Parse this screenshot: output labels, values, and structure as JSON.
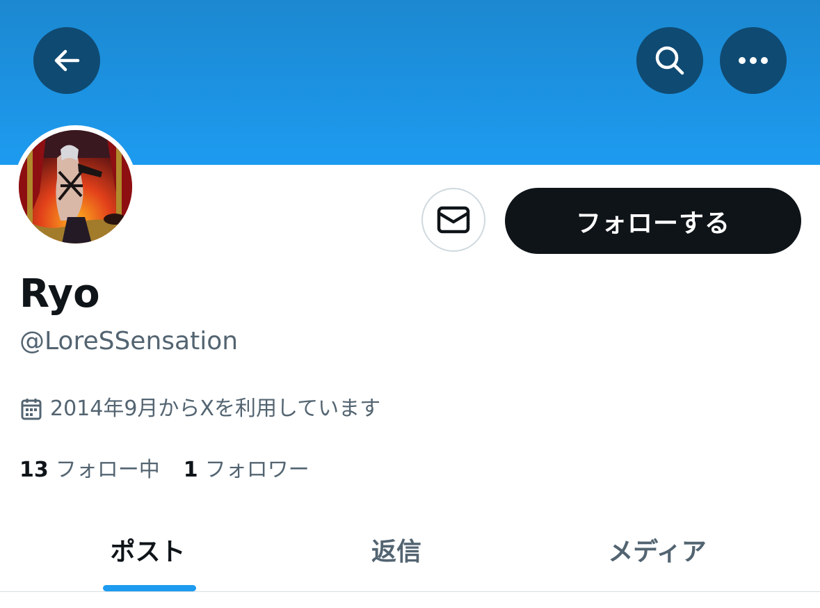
{
  "header": {
    "back_icon": "arrow-left-icon",
    "search_icon": "search-icon",
    "more_icon": "more-horizontal-icon",
    "banner_color": "#1d9bf0"
  },
  "profile": {
    "display_name": "Ryo",
    "handle": "@LoreSSensation",
    "joined": "2014年9月からXを利用しています",
    "joined_icon": "calendar-icon"
  },
  "actions": {
    "message_icon": "mail-icon",
    "follow_label": "フォローする"
  },
  "stats": {
    "following_count": "13",
    "following_label": "フォロー中",
    "followers_count": "1",
    "followers_label": "フォロワー"
  },
  "tabs": [
    {
      "label": "ポスト",
      "active": true
    },
    {
      "label": "返信",
      "active": false
    },
    {
      "label": "メディア",
      "active": false
    }
  ],
  "colors": {
    "accent": "#1d9bf0",
    "text_primary": "#0f1419",
    "text_secondary": "#536471",
    "button_dark": "#0f1419",
    "header_button": "#0f4a72"
  }
}
